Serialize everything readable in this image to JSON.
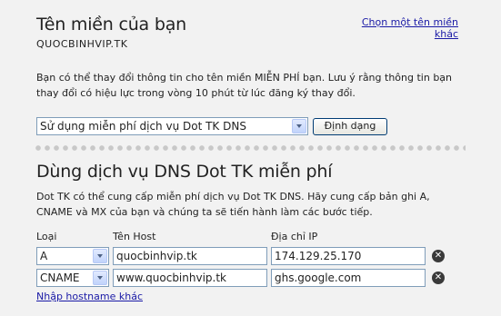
{
  "domain_section": {
    "title": "Tên miền của bạn",
    "domain_name": "QUOCBINHVIP.TK",
    "other_domain_link": "Chọn một tên miền khác",
    "description": "Bạn có thể thay đổi thông tin cho tên miền MIỄN PHÍ bạn. Lưu ý rằng thông tin bạn thay đổi có hiệu lực trong vòng 10 phút từ lúc đăng ký thay đổi.",
    "service_select_value": "Sử dụng miễn phí dịch vụ Dot TK DNS",
    "configure_button": "Định dạng"
  },
  "dns_section": {
    "title": "Dùng dịch vụ DNS Dot TK miễn phí",
    "description": "Dot TK có thể cung cấp miễn phí dịch vụ Dot TK DNS. Hãy cung cấp bản ghi A, CNAME và MX của bạn và chúng ta sẽ tiến hành làm các bước tiếp.",
    "columns": [
      "Loại",
      "Tên Host",
      "Địa chỉ IP"
    ],
    "records": [
      {
        "type": "A",
        "host": "quocbinhvip.tk",
        "value": "174.129.25.170"
      },
      {
        "type": "CNAME",
        "host": "www.quocbinhvip.tk",
        "value": "ghs.google.com"
      }
    ],
    "add_host_link": "Nhập hostname khác"
  },
  "icons": {
    "delete": "delete-circle-icon",
    "dropdown": "chevron-down-icon"
  }
}
